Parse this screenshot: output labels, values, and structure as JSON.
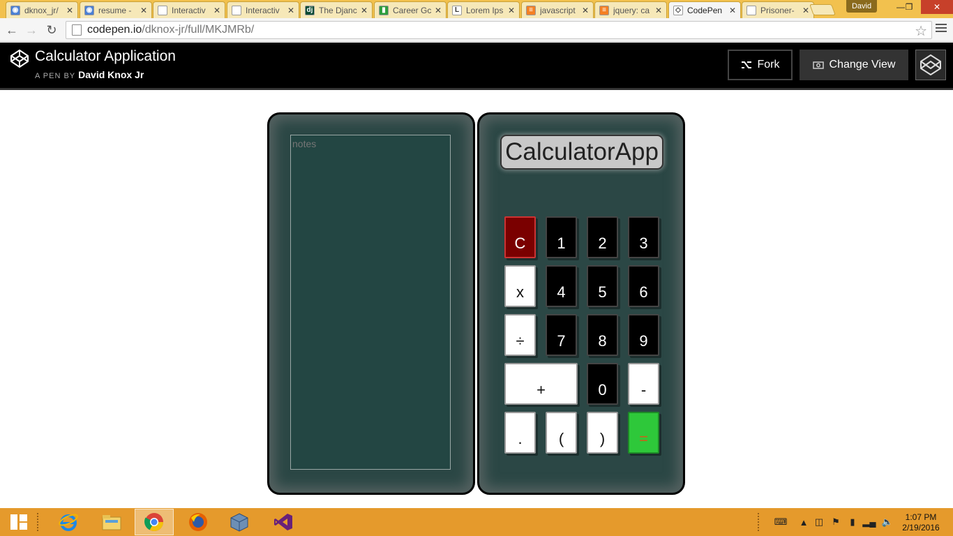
{
  "browser": {
    "tabs": [
      {
        "title": "dknox_jr/",
        "icon_color": "#4a7fd4",
        "icon_glyph": "◉",
        "active": false
      },
      {
        "title": "resume -",
        "icon_color": "#4a7fd4",
        "icon_glyph": "◉",
        "active": false
      },
      {
        "title": "Interactiv",
        "icon_color": "#ffffff",
        "icon_glyph": "",
        "active": false
      },
      {
        "title": "Interactiv",
        "icon_color": "#ffffff",
        "icon_glyph": "",
        "active": false
      },
      {
        "title": "The Djanc",
        "icon_color": "#0c4b33",
        "icon_glyph": "dj",
        "active": false
      },
      {
        "title": "Career Gc",
        "icon_color": "#2e9e3c",
        "icon_glyph": "▮",
        "active": false
      },
      {
        "title": "Lorem Ips",
        "icon_color": "#ffffff",
        "icon_glyph": "L",
        "active": false
      },
      {
        "title": "javascript",
        "icon_color": "#f48024",
        "icon_glyph": "≡",
        "active": false
      },
      {
        "title": "jquery: ca",
        "icon_color": "#f48024",
        "icon_glyph": "≡",
        "active": false
      },
      {
        "title": "CodePen",
        "icon_color": "#ffffff",
        "icon_glyph": "◇",
        "active": true
      },
      {
        "title": "Prisoner-",
        "icon_color": "#ffffff",
        "icon_glyph": "",
        "active": false
      }
    ],
    "user": "David",
    "url_host": "codepen.io",
    "url_path": "/dknox-jr/full/MKJMRb/"
  },
  "header": {
    "title": "Calculator Application",
    "byline": "A PEN BY",
    "author": "David Knox Jr",
    "fork_label": "Fork",
    "change_view_label": "Change View"
  },
  "notes": {
    "placeholder": "notes"
  },
  "calculator": {
    "display": "CalculatorApp",
    "keys": {
      "clear": "C",
      "one": "1",
      "two": "2",
      "three": "3",
      "multiply": "x",
      "four": "4",
      "five": "5",
      "six": "6",
      "divide": "÷",
      "seven": "7",
      "eight": "8",
      "nine": "9",
      "plus": "+",
      "zero": "0",
      "minus": "-",
      "decimal": ".",
      "open_paren": "(",
      "close_paren": ")",
      "equals": "="
    },
    "colors": {
      "panel": "#2b4745",
      "clear_key": "#7a0000",
      "equals_key": "#2ec83a"
    }
  },
  "taskbar": {
    "apps": [
      "internet-explorer",
      "file-explorer",
      "chrome",
      "firefox",
      "virtualbox",
      "visual-studio"
    ],
    "time": "1:07 PM",
    "date": "2/19/2016"
  }
}
